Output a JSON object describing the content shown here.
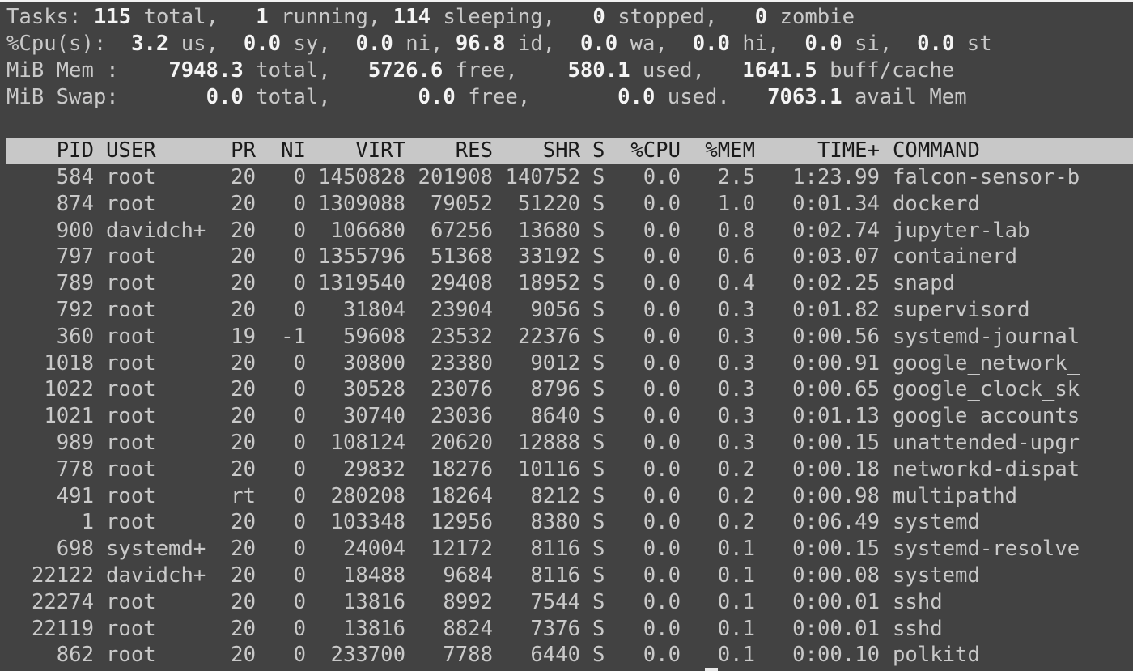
{
  "summary": {
    "tasks": {
      "label": "Tasks:",
      "total": "115",
      "total_label": "total,",
      "running": "1",
      "running_label": "running,",
      "sleeping": "114",
      "sleeping_label": "sleeping,",
      "stopped": "0",
      "stopped_label": "stopped,",
      "zombie": "0",
      "zombie_label": "zombie"
    },
    "cpu": {
      "label": "%Cpu(s):",
      "us": "3.2",
      "us_label": "us,",
      "sy": "0.0",
      "sy_label": "sy,",
      "ni": "0.0",
      "ni_label": "ni,",
      "id": "96.8",
      "id_label": "id,",
      "wa": "0.0",
      "wa_label": "wa,",
      "hi": "0.0",
      "hi_label": "hi,",
      "si": "0.0",
      "si_label": "si,",
      "st": "0.0",
      "st_label": "st"
    },
    "mem": {
      "label": "MiB Mem :",
      "total": "7948.3",
      "total_label": "total,",
      "free": "5726.6",
      "free_label": "free,",
      "used": "580.1",
      "used_label": "used,",
      "buff": "1641.5",
      "buff_label": "buff/cache"
    },
    "swap": {
      "label": "MiB Swap:",
      "total": "0.0",
      "total_label": "total,",
      "free": "0.0",
      "free_label": "free,",
      "used": "0.0",
      "used_label": "used.",
      "avail": "7063.1",
      "avail_label": "avail Mem"
    }
  },
  "table": {
    "columns": [
      "PID",
      "USER",
      "PR",
      "NI",
      "VIRT",
      "RES",
      "SHR",
      "S",
      "%CPU",
      "%MEM",
      "TIME+",
      "COMMAND"
    ],
    "rows": [
      [
        "584",
        "root",
        "20",
        "0",
        "1450828",
        "201908",
        "140752",
        "S",
        "0.0",
        "2.5",
        "1:23.99",
        "falcon-sensor-b"
      ],
      [
        "874",
        "root",
        "20",
        "0",
        "1309088",
        "79052",
        "51220",
        "S",
        "0.0",
        "1.0",
        "0:01.34",
        "dockerd"
      ],
      [
        "900",
        "davidch+",
        "20",
        "0",
        "106680",
        "67256",
        "13680",
        "S",
        "0.0",
        "0.8",
        "0:02.74",
        "jupyter-lab"
      ],
      [
        "797",
        "root",
        "20",
        "0",
        "1355796",
        "51368",
        "33192",
        "S",
        "0.0",
        "0.6",
        "0:03.07",
        "containerd"
      ],
      [
        "789",
        "root",
        "20",
        "0",
        "1319540",
        "29408",
        "18952",
        "S",
        "0.0",
        "0.4",
        "0:02.25",
        "snapd"
      ],
      [
        "792",
        "root",
        "20",
        "0",
        "31804",
        "23904",
        "9056",
        "S",
        "0.0",
        "0.3",
        "0:01.82",
        "supervisord"
      ],
      [
        "360",
        "root",
        "19",
        "-1",
        "59608",
        "23532",
        "22376",
        "S",
        "0.0",
        "0.3",
        "0:00.56",
        "systemd-journal"
      ],
      [
        "1018",
        "root",
        "20",
        "0",
        "30800",
        "23380",
        "9012",
        "S",
        "0.0",
        "0.3",
        "0:00.91",
        "google_network_"
      ],
      [
        "1022",
        "root",
        "20",
        "0",
        "30528",
        "23076",
        "8796",
        "S",
        "0.0",
        "0.3",
        "0:00.65",
        "google_clock_sk"
      ],
      [
        "1021",
        "root",
        "20",
        "0",
        "30740",
        "23036",
        "8640",
        "S",
        "0.0",
        "0.3",
        "0:01.13",
        "google_accounts"
      ],
      [
        "989",
        "root",
        "20",
        "0",
        "108124",
        "20620",
        "12888",
        "S",
        "0.0",
        "0.3",
        "0:00.15",
        "unattended-upgr"
      ],
      [
        "778",
        "root",
        "20",
        "0",
        "29832",
        "18276",
        "10116",
        "S",
        "0.0",
        "0.2",
        "0:00.18",
        "networkd-dispat"
      ],
      [
        "491",
        "root",
        "rt",
        "0",
        "280208",
        "18264",
        "8212",
        "S",
        "0.0",
        "0.2",
        "0:00.98",
        "multipathd"
      ],
      [
        "1",
        "root",
        "20",
        "0",
        "103348",
        "12956",
        "8380",
        "S",
        "0.0",
        "0.2",
        "0:06.49",
        "systemd"
      ],
      [
        "698",
        "systemd+",
        "20",
        "0",
        "24004",
        "12172",
        "8116",
        "S",
        "0.0",
        "0.1",
        "0:00.15",
        "systemd-resolve"
      ],
      [
        "22122",
        "davidch+",
        "20",
        "0",
        "18488",
        "9684",
        "8116",
        "S",
        "0.0",
        "0.1",
        "0:00.08",
        "systemd"
      ],
      [
        "22274",
        "root",
        "20",
        "0",
        "13816",
        "8992",
        "7544",
        "S",
        "0.0",
        "0.1",
        "0:00.01",
        "sshd"
      ],
      [
        "22119",
        "root",
        "20",
        "0",
        "13816",
        "8824",
        "7376",
        "S",
        "0.0",
        "0.1",
        "0:00.01",
        "sshd"
      ],
      [
        "862",
        "root",
        "20",
        "0",
        "233700",
        "7788",
        "6440",
        "S",
        "0.0",
        "0.1",
        "0:00.10",
        "polkitd"
      ]
    ]
  },
  "colors": {
    "background": "#424242",
    "text": "#c9c9c9",
    "bold": "#f4f4f4",
    "header_bg": "#c8c8c8",
    "header_text": "#1a1a1a"
  }
}
